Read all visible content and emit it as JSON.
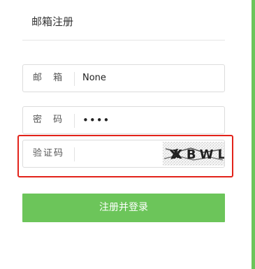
{
  "page": {
    "title": "邮箱注册"
  },
  "form": {
    "email": {
      "label": "邮 箱",
      "value": "None"
    },
    "password": {
      "label": "密 码",
      "value": "••••"
    },
    "captcha": {
      "label": "验证码",
      "image_text": "XBWL"
    },
    "submit_label": "注册并登录"
  },
  "colors": {
    "accent": "#6cc55a",
    "highlight": "#e2231a"
  }
}
